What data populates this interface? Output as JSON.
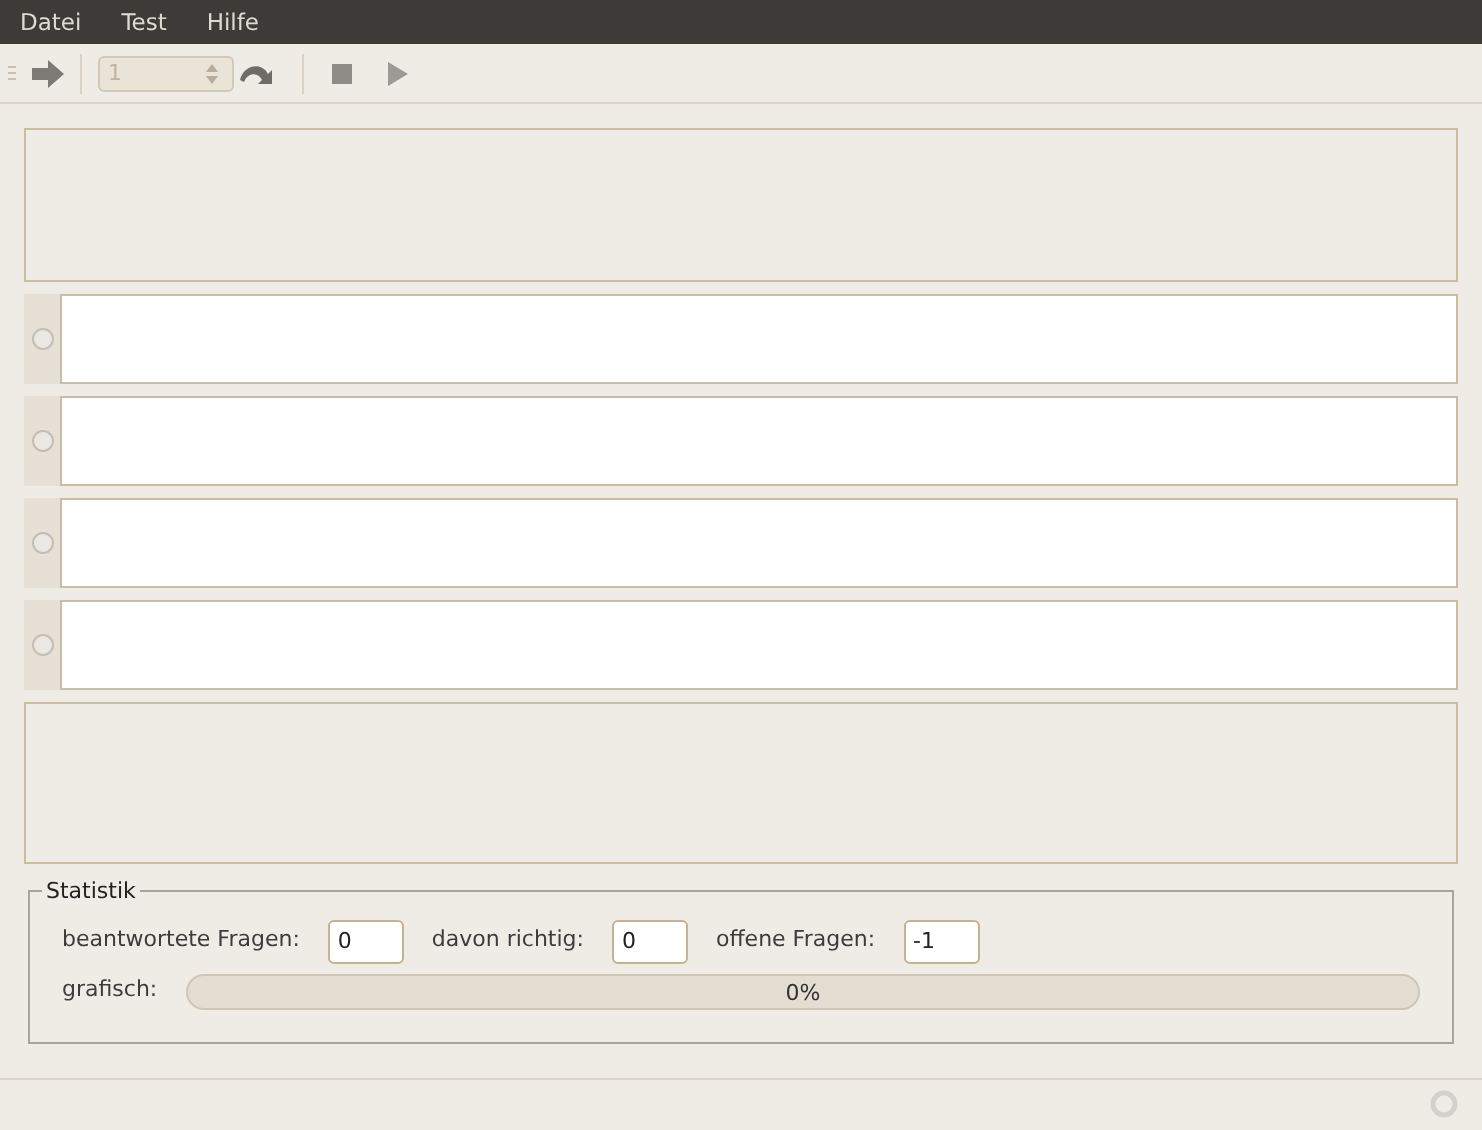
{
  "menu": [
    "Datei",
    "Test",
    "Hilfe"
  ],
  "toolbar": {
    "spinner": {
      "value": "1",
      "disabled": true
    }
  },
  "answers": [
    {
      "selected": false
    },
    {
      "selected": false
    },
    {
      "selected": false
    },
    {
      "selected": false
    }
  ],
  "statistics": {
    "title": "Statistik",
    "fields": [
      {
        "label": "beantwortete Fragen:",
        "value": "0"
      },
      {
        "label": "davon richtig:",
        "value": "0"
      },
      {
        "label": "offene Fragen:",
        "value": "-1"
      }
    ],
    "progress": {
      "label": "grafisch:",
      "level": 0,
      "reading": "0%"
    }
  }
}
